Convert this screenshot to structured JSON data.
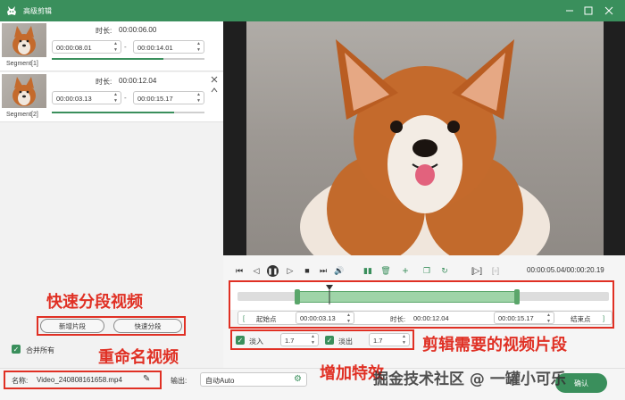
{
  "window": {
    "title": "高级剪辑",
    "accent": "#3a8f5c"
  },
  "segments": [
    {
      "label": "Segment[1]",
      "duration_label": "时长:",
      "duration": "00:00:06.00",
      "start": "00:00:08.01",
      "end": "00:00:14.01",
      "progress": 0.73
    },
    {
      "label": "Segment[2]",
      "duration_label": "时长:",
      "duration": "00:00:12.04",
      "start": "00:00:03.13",
      "end": "00:00:15.17",
      "progress": 0.8
    }
  ],
  "left_actions": {
    "add_segment": "新增片段",
    "quick_split": "快速分段",
    "merge_all": "合并所有"
  },
  "output": {
    "name_label": "名称:",
    "filename": "Video_240808161658.mp4",
    "output_label": "输出:",
    "output_value": "自动Auto"
  },
  "player": {
    "timecode": "00:00:05.04/00:00:20.19"
  },
  "timeline": {
    "start_button": "起始点",
    "start_value": "00:00:03.13",
    "duration_label": "时长:",
    "duration_value": "00:00:12.04",
    "end_value": "00:00:15.17",
    "end_button": "结束点"
  },
  "effects": {
    "fade_in_label": "淡入",
    "fade_in_value": "1.7",
    "fade_out_label": "淡出",
    "fade_out_value": "1.7"
  },
  "annotations": {
    "quick_split": "快速分段视频",
    "rename": "重命名视频",
    "clip": "剪辑需要的视频片段",
    "effects": "增加特效"
  },
  "watermark": "掘金技术社区 @ 一罐小可乐",
  "confirm_label": "确认"
}
